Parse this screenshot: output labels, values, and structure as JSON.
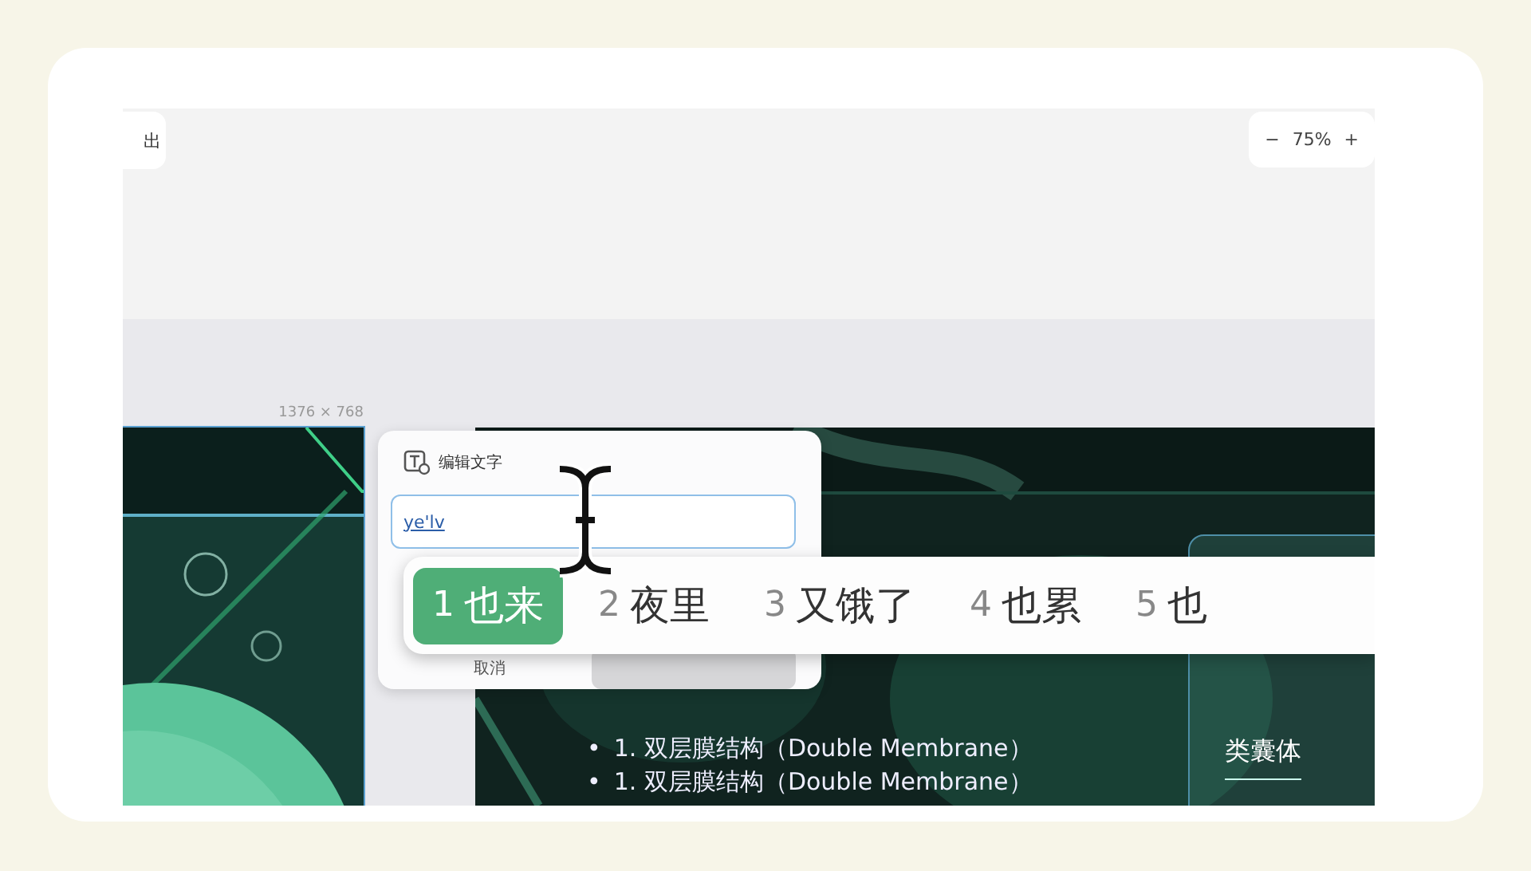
{
  "toolbar": {
    "exit_button": "出",
    "zoom": {
      "minus": "−",
      "value": "75%",
      "plus": "+"
    }
  },
  "canvas": {
    "size_label": "1376 × 768"
  },
  "edit_popup": {
    "title": "编辑文字",
    "input": {
      "value": "ye'lv"
    },
    "cancel_button": "取消"
  },
  "ime_candidates": [
    {
      "index": "1",
      "text": "也来",
      "selected": true
    },
    {
      "index": "2",
      "text": "夜里",
      "selected": false
    },
    {
      "index": "3",
      "text": "又饿了",
      "selected": false
    },
    {
      "index": "4",
      "text": "也累",
      "selected": false
    },
    {
      "index": "5",
      "text": "也",
      "selected": false
    }
  ],
  "slide": {
    "bullets": [
      {
        "marker": "•",
        "text": "1. 双层膜结构（Double Membrane）"
      },
      {
        "marker": "•",
        "text": "1. 双层膜结构（Double Membrane）"
      }
    ],
    "callout": "类囊体"
  }
}
